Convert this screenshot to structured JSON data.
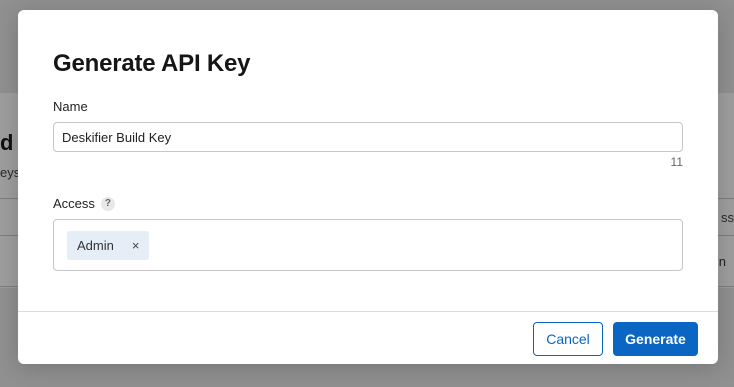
{
  "background": {
    "heading_fragment": "d",
    "subtext_fragment": "eys",
    "column_fragment": "ss",
    "cell_fragment": "n"
  },
  "modal": {
    "title": "Generate API Key",
    "name_field": {
      "label": "Name",
      "value": "Deskifier Build Key",
      "char_count": "11"
    },
    "access_field": {
      "label": "Access",
      "help_icon": "?",
      "selected_chips": [
        {
          "label": "Admin",
          "remove_icon": "×"
        }
      ]
    },
    "buttons": {
      "cancel_label": "Cancel",
      "generate_label": "Generate"
    }
  },
  "colors": {
    "primary": "#0a66c2",
    "chip_background": "#e5eef7",
    "overlay": "#7a7a7a"
  }
}
